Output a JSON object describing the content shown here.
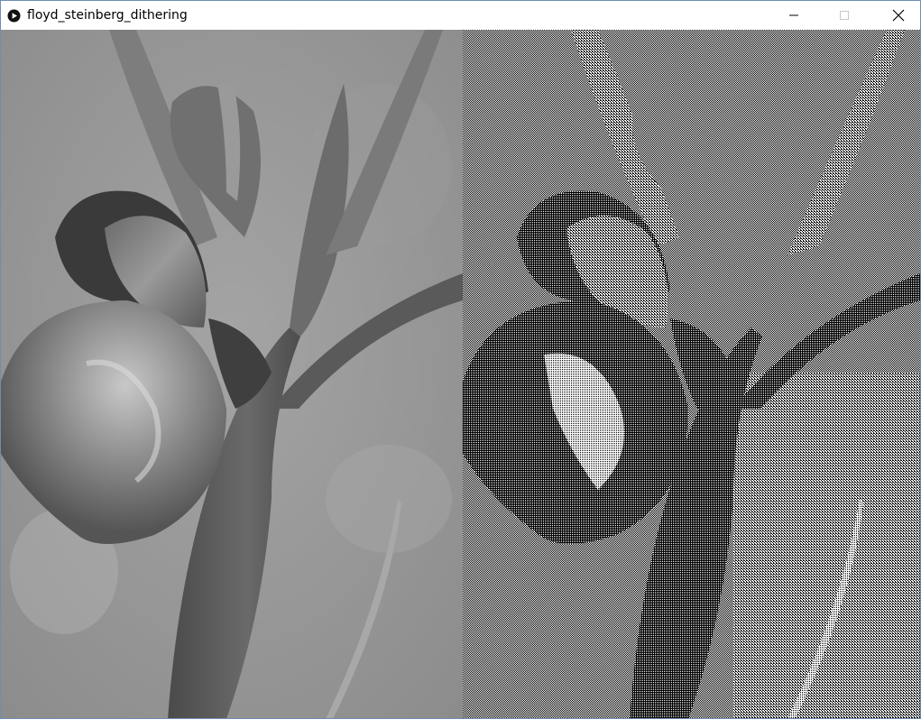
{
  "window": {
    "title": "floyd_steinberg_dithering"
  },
  "controls": {
    "icons": [
      "minimize-icon",
      "maximize-icon",
      "close-icon"
    ]
  },
  "canvas": {
    "panels": [
      {
        "name": "original-grayscale-image",
        "content": "iris-flower-photo"
      },
      {
        "name": "dithered-image",
        "content": "iris-flower-floyd-steinberg-dithered"
      }
    ]
  },
  "colors": {
    "title_bar": "#ffffff",
    "border": "#6d8fb3",
    "background_gray": "#8f8f8f"
  }
}
